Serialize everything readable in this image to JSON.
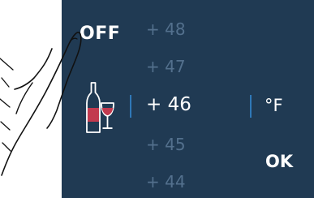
{
  "panel": {
    "background_color": "#203a53",
    "accent_color": "#2f78b8",
    "off_label": "OFF",
    "ok_label": "OK",
    "unit_label": "°F",
    "icon": "wine-bottle-and-glass-icon"
  },
  "temperature_picker": {
    "options": [
      "+ 48",
      "+ 47",
      "+ 46",
      "+ 45",
      "+ 44"
    ],
    "selected": "+ 46"
  }
}
